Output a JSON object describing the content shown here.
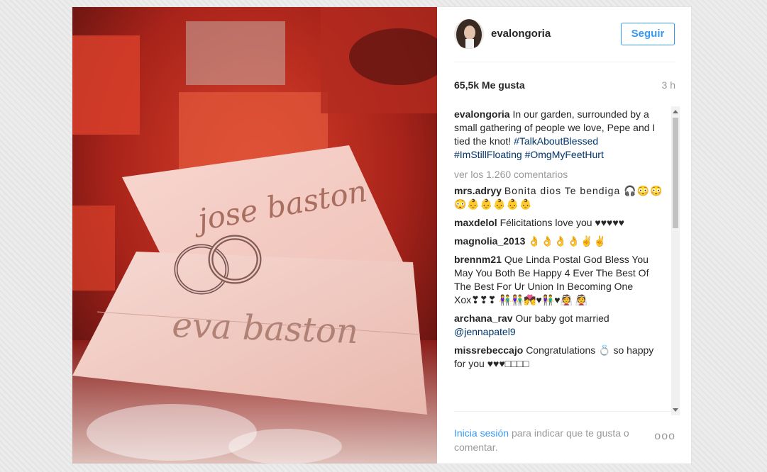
{
  "post": {
    "username": "evalongoria",
    "follow_label": "Seguir",
    "likes": "65,5k Me gusta",
    "time": "3 h",
    "caption": {
      "user": "evalongoria",
      "text": "In our garden, surrounded by a small gathering of people we love, Pepe and I tied the knot!",
      "hashtags": [
        "#TalkAboutBlessed",
        "#ImStillFloating",
        "#OmgMyFeetHurt"
      ]
    },
    "view_more": "ver los 1.260 comentarios",
    "comments": [
      {
        "user": "mrs.adryy",
        "text": "Bonita dios Te bendiga 🎧😳😳 😳👶👶👶👶👶"
      },
      {
        "user": "maxdelol",
        "text": "Félicitations love you ♥♥♥♥♥"
      },
      {
        "user": "magnolia_2013",
        "text": "👌👌👌👌✌✌"
      },
      {
        "user": "brennm21",
        "text": "Que Linda Postal God Bless You May You Both Be Happy 4 Ever The Best Of The Best For Ur Union In Becoming One Xox❣❣❣ 👫👫💏♥👫♥👰 👰"
      },
      {
        "user": "archana_rav",
        "text": "Our baby got married",
        "mention": "@jennapatel9"
      },
      {
        "user": "missrebeccajo",
        "text": "Congratulations 💍 so happy for you ♥♥♥□□□□"
      }
    ],
    "footer": {
      "login_link": "Inicia sesión",
      "login_text": "para indicar que te gusta o comentar.",
      "more_label": "ooo"
    },
    "photo_text": {
      "card_top": "jose baston",
      "card_bottom": "eva baston"
    }
  },
  "colors": {
    "accent": "#3897f0",
    "hashtag": "#003569",
    "muted": "#999999"
  },
  "icons": [
    "avatar",
    "more-options-icon",
    "scroll-up-icon",
    "scroll-down-icon"
  ]
}
